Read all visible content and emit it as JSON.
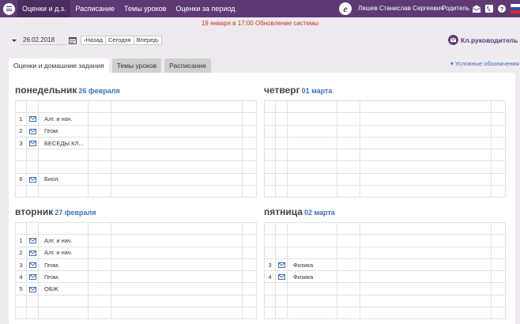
{
  "nav": {
    "items": [
      {
        "label": "Оценки и д.з.",
        "active": true
      },
      {
        "label": "Расписание",
        "active": false
      },
      {
        "label": "Темы уроков",
        "active": false
      },
      {
        "label": "Оценки за период",
        "active": false
      }
    ],
    "logo_letter": "e",
    "user_name": "Ляшев Станислав Сергеевич",
    "role": "Родитель"
  },
  "notice": "19 января в 17:00 Обновление системы",
  "toolbar": {
    "date_value": "26.02.2018",
    "back_label": "Назад",
    "today_label": "Сегодня",
    "forward_label": "Вперед",
    "supervisor_label": "Кл.руководитель"
  },
  "tabs": [
    {
      "label": "Оценки и домашние задания",
      "active": true
    },
    {
      "label": "Темы уроков",
      "active": false
    },
    {
      "label": "Расписание",
      "active": false
    }
  ],
  "legend_link": "Условные обозначения",
  "days": [
    {
      "name": "понедельник",
      "date": "26 февраля",
      "rows": [
        {
          "num": "",
          "icon": false,
          "subject": ""
        },
        {
          "num": "1",
          "icon": true,
          "subject": "Алг. и нач."
        },
        {
          "num": "2",
          "icon": true,
          "subject": "Геом."
        },
        {
          "num": "3",
          "icon": true,
          "subject": "БЕСЕДЫ КЛ..."
        },
        {
          "num": "",
          "icon": false,
          "subject": ""
        },
        {
          "num": "",
          "icon": false,
          "subject": ""
        },
        {
          "num": "6",
          "icon": true,
          "subject": "Биол."
        },
        {
          "num": "",
          "icon": false,
          "subject": ""
        }
      ]
    },
    {
      "name": "четверг",
      "date": "01 марта",
      "rows": [
        {
          "num": "",
          "icon": false,
          "subject": ""
        },
        {
          "num": "",
          "icon": false,
          "subject": ""
        },
        {
          "num": "",
          "icon": false,
          "subject": ""
        },
        {
          "num": "",
          "icon": false,
          "subject": ""
        },
        {
          "num": "",
          "icon": false,
          "subject": ""
        },
        {
          "num": "",
          "icon": false,
          "subject": ""
        },
        {
          "num": "",
          "icon": false,
          "subject": ""
        },
        {
          "num": "",
          "icon": false,
          "subject": ""
        }
      ]
    },
    {
      "name": "вторник",
      "date": "27 февраля",
      "rows": [
        {
          "num": "",
          "icon": false,
          "subject": ""
        },
        {
          "num": "1",
          "icon": true,
          "subject": "Алг. и нач."
        },
        {
          "num": "2",
          "icon": true,
          "subject": "Алг. и нач."
        },
        {
          "num": "3",
          "icon": true,
          "subject": "Геом."
        },
        {
          "num": "4",
          "icon": true,
          "subject": "Геом."
        },
        {
          "num": "5",
          "icon": true,
          "subject": "ОБЖ"
        },
        {
          "num": "",
          "icon": false,
          "subject": ""
        },
        {
          "num": "",
          "icon": false,
          "subject": ""
        }
      ]
    },
    {
      "name": "пятница",
      "date": "02 марта",
      "rows": [
        {
          "num": "",
          "icon": false,
          "subject": ""
        },
        {
          "num": "",
          "icon": false,
          "subject": ""
        },
        {
          "num": "",
          "icon": false,
          "subject": ""
        },
        {
          "num": "3",
          "icon": true,
          "subject": "Физика"
        },
        {
          "num": "4",
          "icon": true,
          "subject": "Физика"
        },
        {
          "num": "",
          "icon": false,
          "subject": ""
        },
        {
          "num": "",
          "icon": false,
          "subject": ""
        },
        {
          "num": "",
          "icon": false,
          "subject": ""
        }
      ]
    }
  ],
  "colors": {
    "header_bg": "#5d3a74",
    "active_nav_bg": "#4a2d5e",
    "notice": "#c0392b",
    "link_blue": "#3f6fb5"
  },
  "icons": {
    "menu": "hamburger-icon",
    "mail": "envelope-icon",
    "phone": "phone-icon",
    "help": "question-icon",
    "flag": "russian-flag-icon",
    "calendar": "calendar-icon",
    "homework": "envelope-icon"
  }
}
